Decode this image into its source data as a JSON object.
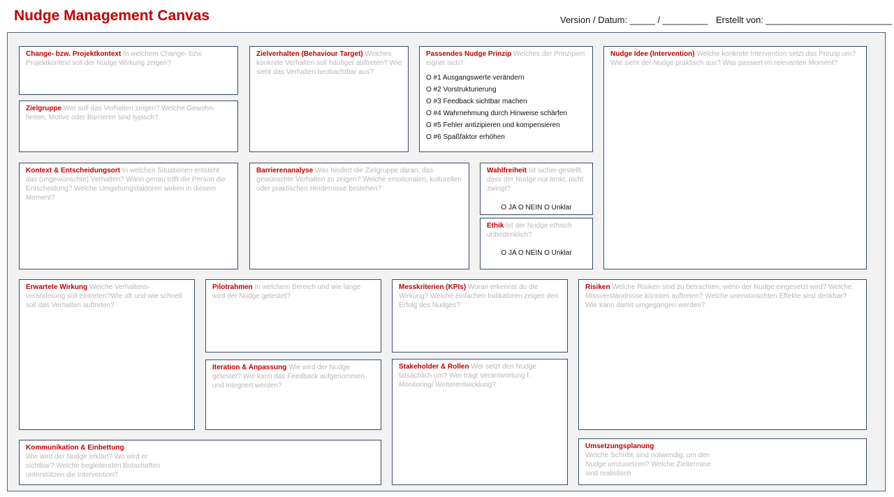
{
  "header": {
    "title": "Nudge Management Canvas",
    "version_label": "Version / Datum: _____ / _________",
    "author_label": "Erstellt von: _________________________"
  },
  "boxes": {
    "kontext": {
      "heading": "Change- bzw. Projektkontext",
      "text": " In welchem Change- bzw. Projektkontext soll der  Nudge Wirkung zeigen?"
    },
    "zielgruppe": {
      "heading": "Zielgruppe",
      "text": " Wer soll das Verhalten zeigen? Welche Gewohn-heiten, Motive oder Barrieren sind typisch?"
    },
    "zielverhalten": {
      "heading": "Zielverhalten (Behaviour Target)",
      "text": " Welches konkrete Verhalten soll häufiger auftreten? Wie sieht das Verhalten beobachtbar aus?"
    },
    "prinzip": {
      "heading": "Passendes Nudge Prinzip",
      "text": " Welches der Prinzipien eignet sich?",
      "options": [
        "O #1 Ausgangswerte verändern",
        "O #2 Vorstrukturierung",
        "O #3 Feedback sichtbar machen",
        "O #4 Wahrnehmung durch Hinweise schärfen",
        "O #5 Fehler antizipieren und kompensieren",
        "O #6 Spaßfaktor erhöhen"
      ]
    },
    "idee": {
      "heading": "Nudge Idee (Intervention)",
      "text": " Welche konkrete Intervention setzt das Prinzip um? Wie sieht der Nudge praktisch aus? Was passiert im relevanten Moment?"
    },
    "entscheidungsort": {
      "heading": "Kontext & Entscheidungsort",
      "text": " In welchen Situationen entsteht das (ungewünschte) Verhalten? Wann genau trifft die Person die Entscheidung? Welche  Umgebungsfaktoren wirken in diesem Moment?"
    },
    "barrieren": {
      "heading": "Barrierenanalyse",
      "text": " Was hindert die Zielgruppe daran, das gewünschte Verhalten zu zeigen? Welche emotionalen, kulturellen oder praktischen Hindernisse bestehen?"
    },
    "wahlfreiheit": {
      "heading": "Wahlfreiheit",
      "text": "  Ist sicher-gestellt, dass der Nudge nur lenkt, nicht zwingt?",
      "choices": "O JA  O NEIN  O Unklar"
    },
    "ethik": {
      "heading": "Ethik",
      "text": " Ist der Nudge ethisch unbedenklich?",
      "choices": "O JA  O NEIN  O Unklar"
    },
    "wirkung": {
      "heading": "Erwartete Wirkung",
      "text": " Welche Verhaltens-veränderung soll eintreten?Wie oft und wie schnell soll das Verhalten auftreten?"
    },
    "pilot": {
      "heading": "Pilotrahmen",
      "text": " In welchem Bereich und wie lange wird der Nudge getestet?"
    },
    "mess": {
      "heading": "Messkriterien (KPIs)",
      "text": " Woran erkennst du die Wirkung? Welche einfachen Indikatoren zeigen den Erfolg des Nudges?"
    },
    "risiken": {
      "heading": "Risiken",
      "text": " Welche Risiken sind zu betrachten, wenn der Nudge eingesetzt wird? Welche Missverständnisse könnten auftreten? Welche unerwünschten Effekte sind denkbar? Wie kann damit umgegangen werden?"
    },
    "iteration": {
      "heading": "Iteration & Anpassung",
      "text": "  Wie wird der Nudge getestet? Wie kann das Feedback aufgenommen und integriert werden?"
    },
    "stakeholder": {
      "heading": "Stakeholder & Rollen",
      "text": " Wer setzt den Nudge tatsächlich um?  Wer trägt Verantwortung f. Monitoring/ Weiterentwicklung?"
    },
    "kommunikation": {
      "heading": "Kommunikation & Einbettung",
      "text": "Wie wird der Nudge erklärt? Wo wird er sichtbar? Welche begleitenden Botschaften unterstützen die Intervention?"
    },
    "umsetzung": {
      "heading": "Umsetzungsplanung",
      "text": "Welche Schritte sind notwendig, um den Nudge umzusetzen? Welche Zieltermine sind realistisch"
    }
  }
}
